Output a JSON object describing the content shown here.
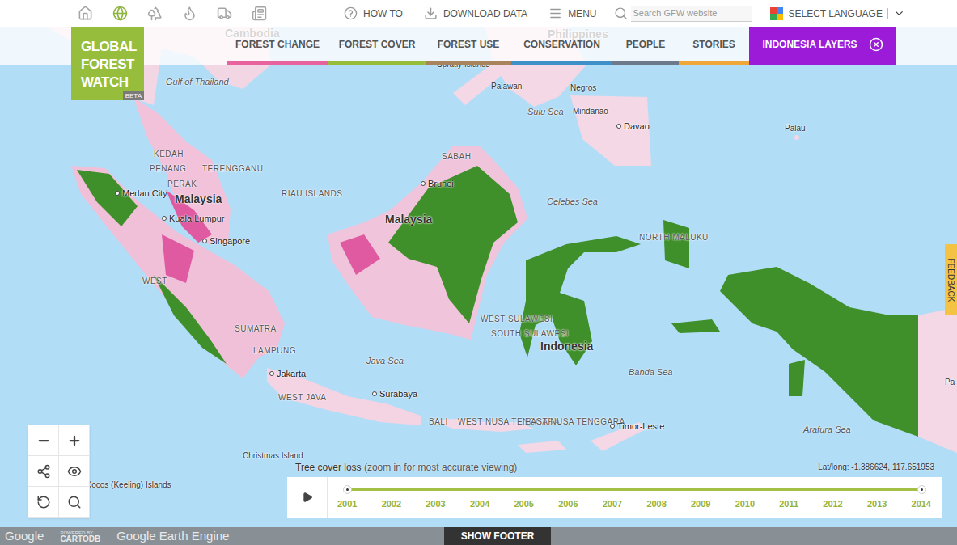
{
  "icon_nav": [
    {
      "selected": false
    },
    {
      "selected": true
    },
    {
      "selected": false
    },
    {
      "selected": false
    },
    {
      "selected": false
    },
    {
      "selected": false
    }
  ],
  "links": [
    "HOW TO",
    "DOWNLOAD DATA",
    "MENU"
  ],
  "search": {
    "placeholder": "Search GFW website"
  },
  "language": {
    "label": "SELECT LANGUAGE"
  },
  "logo": {
    "lines": [
      "GLOBAL",
      "FOREST",
      "WATCH"
    ],
    "badge": "BETA"
  },
  "tabs": [
    {
      "label": "FOREST CHANGE",
      "selected": false,
      "color": "#e8629e"
    },
    {
      "label": "FOREST COVER",
      "selected": false,
      "color": "#97bd3d"
    },
    {
      "label": "FOREST USE",
      "selected": false,
      "color": "#a8835c"
    },
    {
      "label": "CONSERVATION",
      "selected": false,
      "color": "#3f8fc8"
    },
    {
      "label": "PEOPLE",
      "selected": false,
      "color": "#6c7a8c"
    },
    {
      "label": "STORIES",
      "selected": false,
      "color": "#f0a73a"
    },
    {
      "label": "INDONESIA LAYERS",
      "selected": true,
      "color": "#9b1bd8"
    }
  ],
  "map": {
    "labels": [
      {
        "text": "Cambodia",
        "kind": "country"
      },
      {
        "text": "Philippines",
        "kind": "country"
      },
      {
        "text": "Gulf of Thailand",
        "kind": "water"
      },
      {
        "text": "Spratly Islands",
        "kind": "place"
      },
      {
        "text": "Palawan",
        "kind": "place"
      },
      {
        "text": "Negros",
        "kind": "place"
      },
      {
        "text": "Sulu Sea",
        "kind": "water"
      },
      {
        "text": "Mindanao",
        "kind": "place"
      },
      {
        "text": "Davao",
        "kind": "city"
      },
      {
        "text": "Palau",
        "kind": "place"
      },
      {
        "text": "KEDAH",
        "kind": "region"
      },
      {
        "text": "PENANG",
        "kind": "region"
      },
      {
        "text": "TERENGGANU",
        "kind": "region"
      },
      {
        "text": "PERAK",
        "kind": "region"
      },
      {
        "text": "Malaysia",
        "kind": "country"
      },
      {
        "text": "Kuala Lumpur",
        "kind": "city"
      },
      {
        "text": "Medan City",
        "kind": "city"
      },
      {
        "text": "RIAU ISLANDS",
        "kind": "region"
      },
      {
        "text": "Singapore",
        "kind": "city"
      },
      {
        "text": "SABAH",
        "kind": "region"
      },
      {
        "text": "Brunei",
        "kind": "city"
      },
      {
        "text": "Malaysia",
        "kind": "country"
      },
      {
        "text": "Celebes Sea",
        "kind": "water"
      },
      {
        "text": "NORTH MALUKU",
        "kind": "region"
      },
      {
        "text": "WEST",
        "kind": "region"
      },
      {
        "text": "SUMATRA",
        "kind": "region"
      },
      {
        "text": "LAMPUNG",
        "kind": "region"
      },
      {
        "text": "Jakarta",
        "kind": "city"
      },
      {
        "text": "Java Sea",
        "kind": "water"
      },
      {
        "text": "Surabaya",
        "kind": "city"
      },
      {
        "text": "WEST JAVA",
        "kind": "region"
      },
      {
        "text": "BALI",
        "kind": "region"
      },
      {
        "text": "WEST NUSA TENGGARA",
        "kind": "region"
      },
      {
        "text": "EAST NUSA TENGGARA",
        "kind": "region"
      },
      {
        "text": "Timor-Leste",
        "kind": "city"
      },
      {
        "text": "Banda Sea",
        "kind": "water"
      },
      {
        "text": "Indonesia",
        "kind": "country"
      },
      {
        "text": "WEST SULAWESI",
        "kind": "region"
      },
      {
        "text": "SOUTH SULAWESI",
        "kind": "region"
      },
      {
        "text": "Arafura Sea",
        "kind": "water"
      },
      {
        "text": "Christmas Island",
        "kind": "place"
      },
      {
        "text": "Cocos (Keeling) Islands",
        "kind": "place"
      },
      {
        "text": "Pa",
        "kind": "place"
      }
    ],
    "legend": "Tree cover loss",
    "legend_note": "(zoom in for most accurate viewing)",
    "coordinates": "Lat/long: -1.386624, 117.651953"
  },
  "timeline": {
    "years": [
      "2001",
      "2002",
      "2003",
      "2004",
      "2005",
      "2006",
      "2007",
      "2008",
      "2009",
      "2010",
      "2011",
      "2012",
      "2013",
      "2014"
    ],
    "start": 0,
    "end": 1
  },
  "footer": {
    "button": "SHOW FOOTER",
    "credits": [
      "Google",
      "POWERED BY",
      "CARTODB",
      "Google Earth Engine"
    ]
  },
  "feedback": "FEEDBACK"
}
